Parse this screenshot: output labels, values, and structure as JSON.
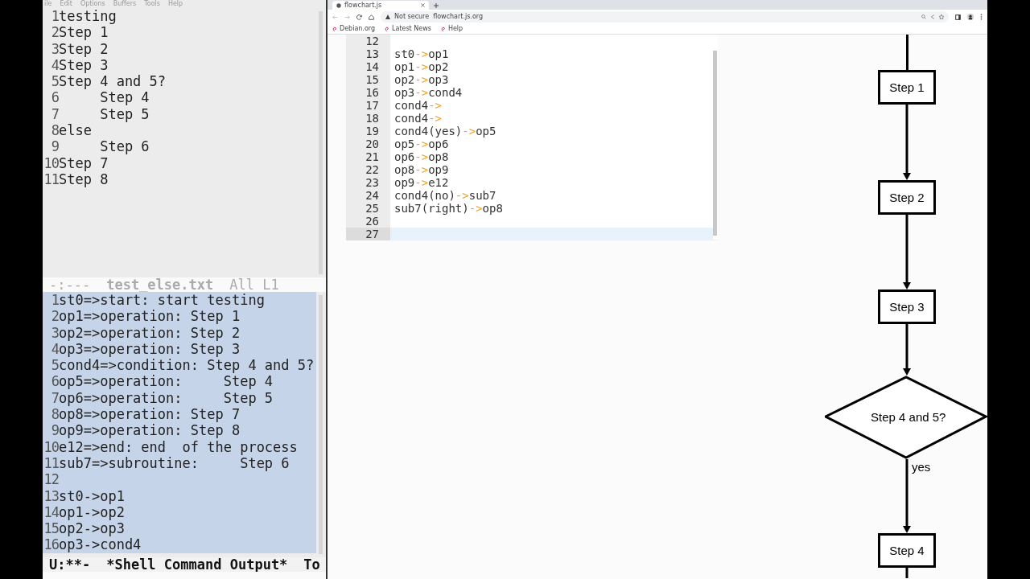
{
  "emacs": {
    "menu": [
      "ile",
      "Edit",
      "Options",
      "Buffers",
      "Tools",
      "Help"
    ],
    "top_buffer": {
      "lines": [
        {
          "num": "1",
          "text": "testing"
        },
        {
          "num": "2",
          "text": "Step 1"
        },
        {
          "num": "3",
          "text": "Step 2"
        },
        {
          "num": "4",
          "text": "Step 3"
        },
        {
          "num": "5",
          "text": "Step 4 and 5?"
        },
        {
          "num": "6",
          "text": "     Step 4"
        },
        {
          "num": "7",
          "text": "     Step 5"
        },
        {
          "num": "8",
          "text": "else"
        },
        {
          "num": "9",
          "text": "     Step 6"
        },
        {
          "num": "10",
          "text": "Step 7"
        },
        {
          "num": "11",
          "text": "Step 8"
        }
      ],
      "mode_line": {
        "status": "-:---",
        "buffer": "test_else.txt",
        "position": "All L1",
        "active": false
      }
    },
    "bottom_buffer": {
      "lines": [
        {
          "num": "1",
          "text": "st0=>start: start testing"
        },
        {
          "num": "2",
          "text": "op1=>operation: Step 1"
        },
        {
          "num": "3",
          "text": "op2=>operation: Step 2"
        },
        {
          "num": "4",
          "text": "op3=>operation: Step 3"
        },
        {
          "num": "5",
          "text": "cond4=>condition: Step 4 and 5?"
        },
        {
          "num": "6",
          "text": "op5=>operation:     Step 4"
        },
        {
          "num": "7",
          "text": "op6=>operation:     Step 5"
        },
        {
          "num": "8",
          "text": "op8=>operation: Step 7"
        },
        {
          "num": "9",
          "text": "op9=>operation: Step 8"
        },
        {
          "num": "10",
          "text": "e12=>end: end  of the process"
        },
        {
          "num": "11",
          "text": "sub7=>subroutine:     Step 6"
        },
        {
          "num": "12"
        },
        {
          "num": "13",
          "text": "st0->op1"
        },
        {
          "num": "14",
          "text": "op1->op2"
        },
        {
          "num": "15",
          "text": "op2->op3"
        },
        {
          "num": "16",
          "text": "op3->cond4"
        }
      ],
      "selected": true,
      "mode_line": {
        "status": "U:**-",
        "buffer": "*Shell Command Output*",
        "position": "To",
        "active": true
      }
    }
  },
  "browser": {
    "tab": {
      "title": "flowchart.js",
      "selected": true
    },
    "address": {
      "security": "Not secure",
      "url": "flowchart.js.org"
    },
    "bookmarks": [
      "Debian.org",
      "Latest News",
      "Help"
    ],
    "editor": {
      "lines": [
        {
          "num": "12",
          "current": false
        },
        {
          "num": "13",
          "parts": [
            "st0",
            "->",
            "op1"
          ],
          "current": false
        },
        {
          "num": "14",
          "parts": [
            "op1",
            "->",
            "op2"
          ],
          "current": false
        },
        {
          "num": "15",
          "parts": [
            "op2",
            "->",
            "op3"
          ],
          "current": false
        },
        {
          "num": "16",
          "parts": [
            "op3",
            "->",
            "cond4"
          ],
          "current": false
        },
        {
          "num": "17",
          "parts": [
            "cond4",
            "->"
          ],
          "current": false
        },
        {
          "num": "18",
          "parts": [
            "cond4",
            "->"
          ],
          "current": false
        },
        {
          "num": "19",
          "parts": [
            "cond4(yes)",
            "->",
            "op5"
          ],
          "current": false
        },
        {
          "num": "20",
          "parts": [
            "op5",
            "->",
            "op6"
          ],
          "current": false
        },
        {
          "num": "21",
          "parts": [
            "op6",
            "->",
            "op8"
          ],
          "current": false
        },
        {
          "num": "22",
          "parts": [
            "op8",
            "->",
            "op9"
          ],
          "current": false
        },
        {
          "num": "23",
          "parts": [
            "op9",
            "->",
            "e12"
          ],
          "current": false
        },
        {
          "num": "24",
          "parts": [
            "cond4(no)",
            "->",
            "sub7"
          ],
          "current": false
        },
        {
          "num": "25",
          "parts": [
            "sub7(right)",
            "->",
            "op8"
          ],
          "current": false
        },
        {
          "num": "26",
          "current": false
        },
        {
          "num": "27",
          "current": true
        }
      ]
    },
    "flowchart": {
      "nodes": [
        {
          "kind": "operation",
          "label": "Step 1"
        },
        {
          "kind": "operation",
          "label": "Step 2"
        },
        {
          "kind": "operation",
          "label": "Step 3"
        },
        {
          "kind": "condition",
          "label": "Step 4 and 5?",
          "branch": "yes"
        },
        {
          "kind": "operation",
          "label": "Step 4"
        }
      ]
    }
  }
}
